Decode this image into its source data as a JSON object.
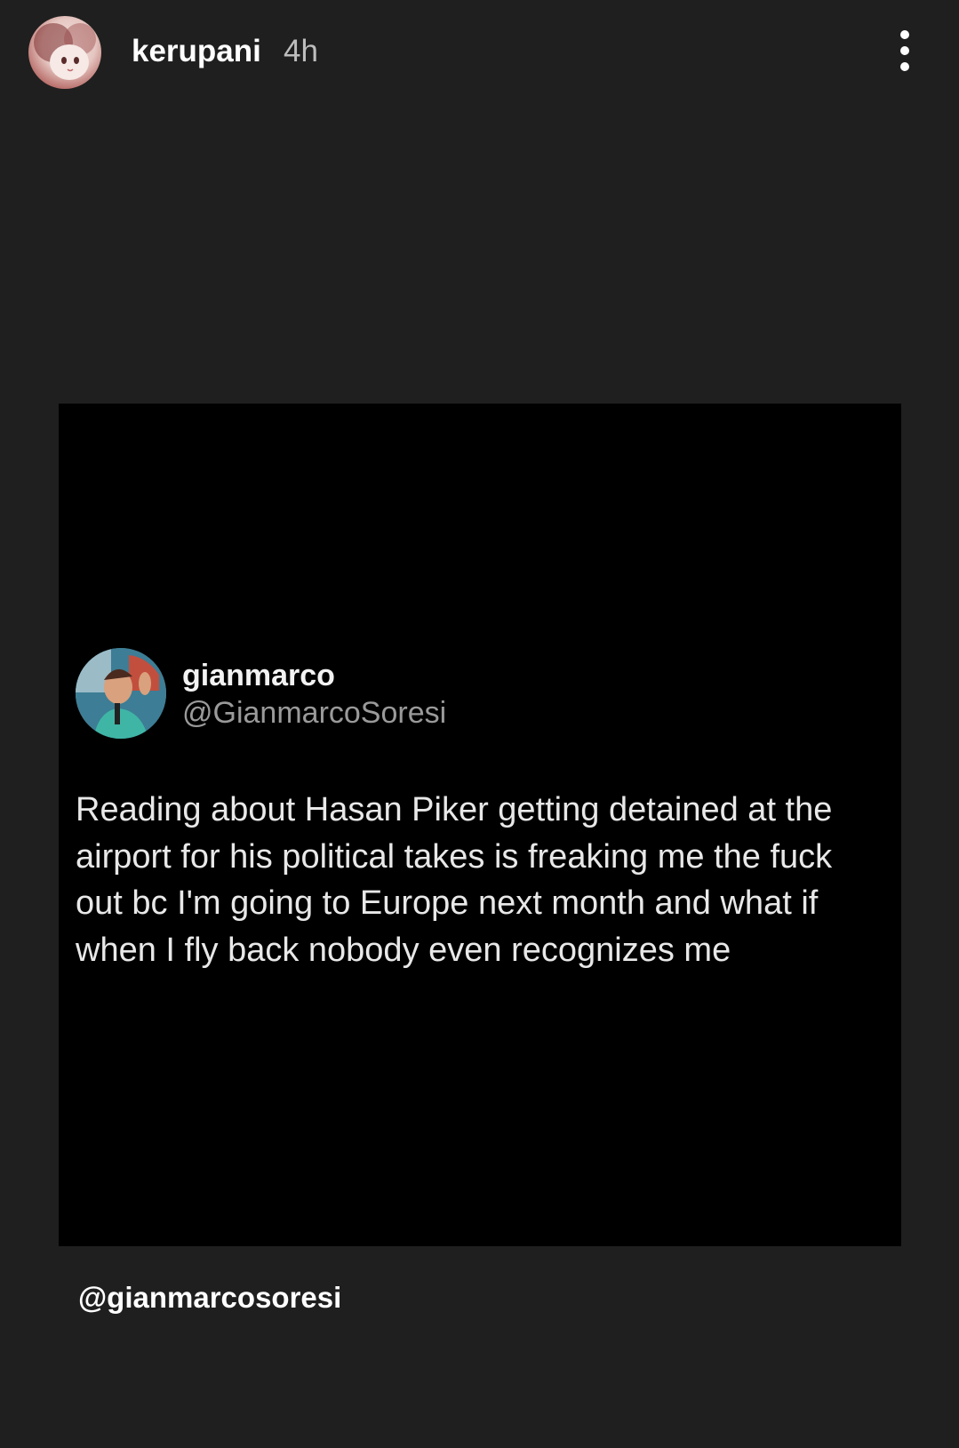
{
  "story": {
    "username": "kerupani",
    "time": "4h",
    "more_icon": "more-vertical-icon"
  },
  "shared_post": {
    "author_name": "gianmarco",
    "author_handle": "@GianmarcoSoresi",
    "text": "Reading about Hasan Piker getting detained at the airport for his political takes is freaking me the fuck out bc I'm going to Europe next month and what if when I fly back nobody even recognizes me"
  },
  "mention_sticker": {
    "label": "@gianmarcosoresi"
  },
  "colors": {
    "background": "#1f1f1f",
    "post_background": "#000000",
    "handle_gray": "#9a9a9a",
    "time_gray": "#bdbdbd"
  }
}
